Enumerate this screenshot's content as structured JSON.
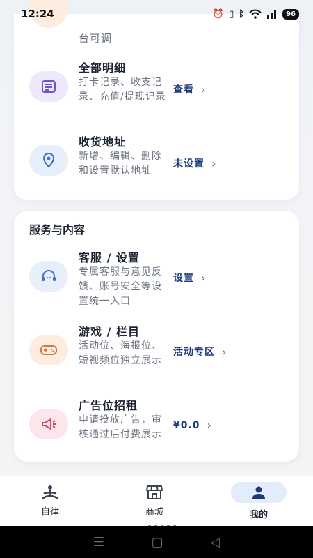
{
  "status": {
    "time": "12:24",
    "battery": "96"
  },
  "card1": {
    "partial_text": "台可调",
    "rows": [
      {
        "title": "全部明细",
        "desc": "打卡记录、收支记录、充值/提现记录",
        "action": "查看",
        "icon": "list-icon",
        "icon_bg": "#efe8fb",
        "icon_color": "#6b57c9"
      },
      {
        "title": "收货地址",
        "desc": "新增、编辑、删除和设置默认地址",
        "action": "未设置",
        "icon": "location-pin-icon",
        "icon_bg": "#e7effb",
        "icon_color": "#3e6fc4"
      }
    ]
  },
  "card2": {
    "title": "服务与内容",
    "rows": [
      {
        "title": "客服 / 设置",
        "desc": "专属客服与意见反馈、账号安全等设置统一入口",
        "action": "设置",
        "icon": "headset-icon",
        "icon_bg": "#e7effb",
        "icon_color": "#3e6fc4"
      },
      {
        "title": "游戏 / 栏目",
        "desc": "活动位、海报位、短视频位独立展示",
        "action": "活动专区",
        "icon": "gamepad-icon",
        "icon_bg": "#fdecdf",
        "icon_color": "#d9743f"
      },
      {
        "title": "广告位招租",
        "desc": "申请投放广告，审核通过后付费展示",
        "action": "¥0.0",
        "icon": "megaphone-icon",
        "icon_bg": "#fbe6ea",
        "icon_color": "#d24a62"
      }
    ]
  },
  "nav": {
    "items": [
      {
        "label": "自律",
        "icon": "meditation-icon"
      },
      {
        "label": "商城",
        "icon": "store-icon"
      },
      {
        "label": "我的",
        "icon": "user-icon",
        "active": true
      }
    ]
  },
  "chevron": "›"
}
